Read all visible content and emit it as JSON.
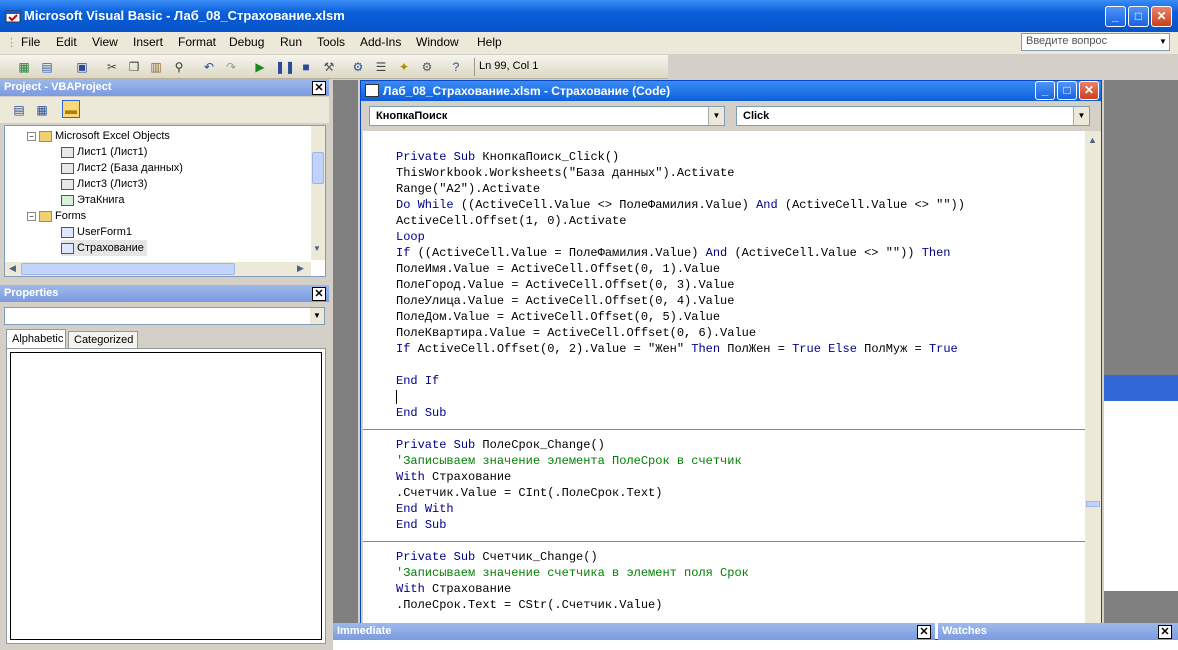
{
  "window": {
    "title": "Microsoft Visual Basic - Лаб_08_Страхование.xlsm"
  },
  "menu": [
    {
      "label": "File"
    },
    {
      "label": "Edit"
    },
    {
      "label": "View"
    },
    {
      "label": "Insert"
    },
    {
      "label": "Format"
    },
    {
      "label": "Debug"
    },
    {
      "label": "Run"
    },
    {
      "label": "Tools"
    },
    {
      "label": "Add-Ins"
    },
    {
      "label": "Window"
    },
    {
      "label": "Help"
    }
  ],
  "ask": {
    "placeholder": "Введите вопрос"
  },
  "toolbar": {
    "position": "Ln 99, Col 1"
  },
  "project": {
    "title": "Project - VBAProject",
    "nodes": [
      {
        "label": "Microsoft Excel Objects"
      },
      {
        "label": "Лист1 (Лист1)"
      },
      {
        "label": "Лист2 (База данных)"
      },
      {
        "label": "Лист3 (Лист3)"
      },
      {
        "label": "ЭтаКнига"
      },
      {
        "label": "Forms"
      },
      {
        "label": "UserForm1"
      },
      {
        "label": "Страхование"
      }
    ]
  },
  "properties": {
    "title": "Properties",
    "tabs": [
      {
        "label": "Alphabetic"
      },
      {
        "label": "Categorized"
      }
    ]
  },
  "code": {
    "title": "Лаб_08_Страхование.xlsm - Страхование (Code)",
    "object": "КнопкаПоиск",
    "procedure": "Click",
    "lines": [
      "Private Sub КнопкаПоиск_Click()",
      "ThisWorkbook.Worksheets(\"База данных\").Activate",
      "Range(\"A2\").Activate",
      "Do While ((ActiveCell.Value <> ПолеФамилия.Value) And (ActiveCell.Value <> \"\"))",
      "ActiveCell.Offset(1, 0).Activate",
      "Loop",
      "If ((ActiveCell.Value = ПолеФамилия.Value) And (ActiveCell.Value <> \"\")) Then",
      "ПолеИмя.Value = ActiveCell.Offset(0, 1).Value",
      "ПолеГород.Value = ActiveCell.Offset(0, 3).Value",
      "ПолеУлица.Value = ActiveCell.Offset(0, 4).Value",
      "ПолеДом.Value = ActiveCell.Offset(0, 5).Value",
      "ПолеКвартира.Value = ActiveCell.Offset(0, 6).Value",
      "If ActiveCell.Offset(0, 2).Value = \"Жен\" Then ПолЖен = True Else ПолМуж = True",
      "",
      "End If",
      "",
      "End Sub",
      "",
      "Private Sub ПолеСрок_Change()",
      "'Записываем значение элемента ПолеСрок в счетчик",
      "With Страхование",
      ".Счетчик.Value = CInt(.ПолеСрок.Text)",
      "End With",
      "End Sub",
      "",
      "Private Sub Счетчик_Change()",
      "'Записываем значение счетчика в элемент поля Срок",
      "With Страхование",
      ".ПолеСрок.Text = CStr(.Счетчик.Value)"
    ]
  },
  "immediate": {
    "title": "Immediate"
  },
  "watches": {
    "title": "Watches"
  }
}
